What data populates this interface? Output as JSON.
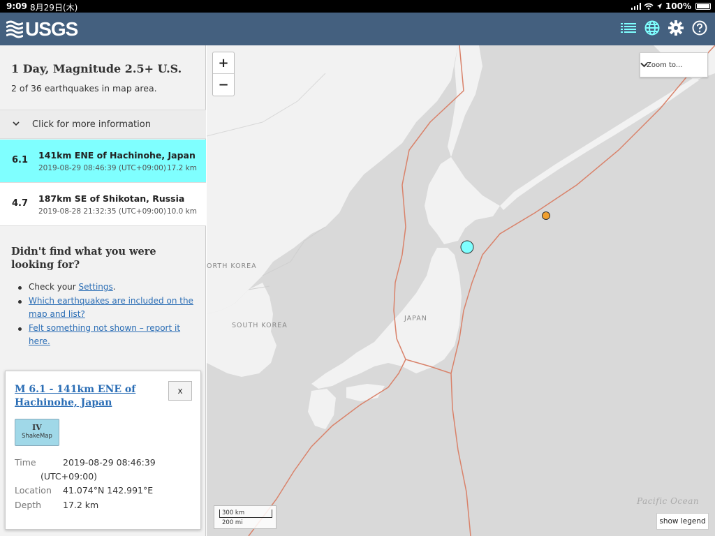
{
  "status_bar": {
    "time": "9:09",
    "date": "8月29日(木)",
    "battery": "100%"
  },
  "header": {
    "logo_text": "USGS",
    "icons": [
      "list-icon",
      "globe-icon",
      "gear-icon",
      "help-icon"
    ]
  },
  "list": {
    "title": "1 Day, Magnitude 2.5+ U.S.",
    "count_text": "2 of 36 earthquakes in map area.",
    "more_info": "Click for more information",
    "earthquakes": [
      {
        "mag": "6.1",
        "place": "141km ENE of Hachinohe, Japan",
        "time": "2019-08-29 08:46:39 (UTC+09:00)",
        "depth": "17.2 km",
        "selected": true
      },
      {
        "mag": "4.7",
        "place": "187km SE of Shikotan, Russia",
        "time": "2019-08-28 21:32:35 (UTC+09:00)",
        "depth": "10.0 km",
        "selected": false
      }
    ]
  },
  "help": {
    "title": "Didn't find what you were looking for?",
    "item1_prefix": "Check your ",
    "item1_link": "Settings",
    "item1_suffix": ".",
    "item2_link": "Which earthquakes are included on the map and list?",
    "item3_link": "Felt something not shown – report it here."
  },
  "popup": {
    "title": "M 6.1 - 141km ENE of Hachinohe, Japan",
    "close_label": "x",
    "shakemap_mmi": "IV",
    "shakemap_label": "ShakeMap",
    "time_label": "Time",
    "time_value": "2019-08-29 08:46:39",
    "time_zone": "(UTC+09:00)",
    "location_label": "Location",
    "location_value": "41.074°N 142.991°E",
    "depth_label": "Depth",
    "depth_value": "17.2 km"
  },
  "map": {
    "zoom_in": "+",
    "zoom_out": "−",
    "zoom_to": "Zoom to...",
    "scale_km": "300 km",
    "scale_mi": "200 mi",
    "show_legend": "show legend",
    "labels": {
      "north_korea": "ORTH KOREA",
      "south_korea": "SOUTH KOREA",
      "japan": "JAPAN",
      "ocean": "Pacific Ocean"
    },
    "colors": {
      "land": "#f2f2f2",
      "sea": "#d9d9d9",
      "plate_boundary": "#d9826a",
      "selected_quake": "#7fffff",
      "other_quake": "#f0a030"
    }
  }
}
